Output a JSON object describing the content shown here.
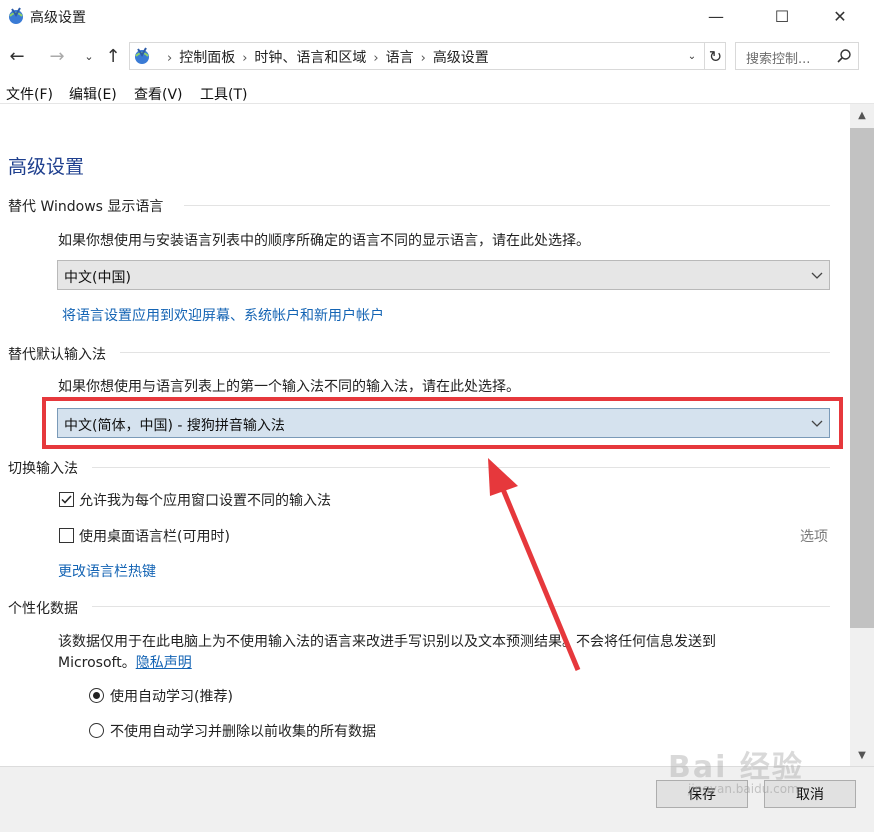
{
  "window": {
    "title": "高级设置",
    "minimize": "—",
    "maximize": "☐",
    "close": "✕"
  },
  "nav": {
    "back": "←",
    "forward": "→",
    "recent": "⌄",
    "up": "↑",
    "breadcrumbs": [
      "控制面板",
      "时钟、语言和区域",
      "语言",
      "高级设置"
    ],
    "separator": "›",
    "dropdown": "⌄",
    "refresh": "↻",
    "search_placeholder": "搜索控制..."
  },
  "menu": [
    "文件(F)",
    "编辑(E)",
    "查看(V)",
    "工具(T)"
  ],
  "page": {
    "title": "高级设置",
    "display_language": {
      "heading": "替代 Windows 显示语言",
      "description": "如果你想使用与安装语言列表中的顺序所确定的语言不同的显示语言，请在此处选择。",
      "selected": "中文(中国)",
      "link": "将语言设置应用到欢迎屏幕、系统帐户和新用户帐户"
    },
    "input_method": {
      "heading": "替代默认输入法",
      "description": "如果你想使用与语言列表上的第一个输入法不同的输入法，请在此处选择。",
      "selected": "中文(简体，中国) - 搜狗拼音输入法"
    },
    "switch": {
      "heading": "切换输入法",
      "checkbox1": "允许我为每个应用窗口设置不同的输入法",
      "checkbox1_checked": true,
      "checkbox2": "使用桌面语言栏(可用时)",
      "checkbox2_checked": false,
      "options": "选项",
      "hotkey_link": "更改语言栏热键"
    },
    "personal": {
      "heading": "个性化数据",
      "description_line1": "该数据仅用于在此电脑上为不使用输入法的语言来改进手写识别以及文本预测结果。不会将任何信息发送到",
      "description_line2": "Microsoft。",
      "privacy_link": "隐私声明",
      "radio1": "使用自动学习(推荐)",
      "radio2": "不使用自动学习并删除以前收集的所有数据",
      "radio_selected": 1
    }
  },
  "buttons": {
    "save": "保存",
    "cancel": "取消"
  },
  "watermark": {
    "main": "Bai 经验",
    "sub": "jingyan.baidu.com"
  },
  "colors": {
    "highlight": "#e6383c",
    "link": "#1464b4",
    "title": "#1e3f8e"
  }
}
